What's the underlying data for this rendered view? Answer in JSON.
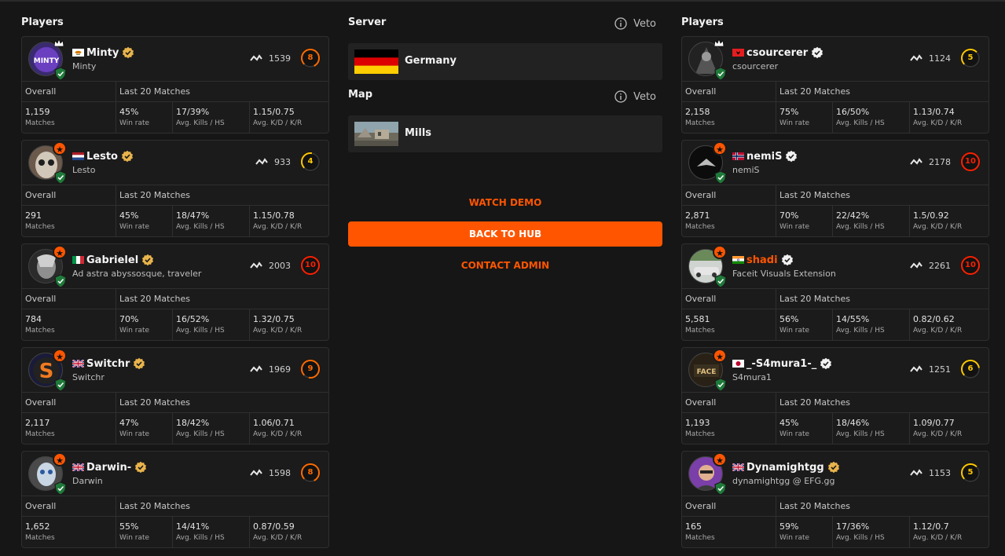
{
  "left": {
    "title": "Players",
    "players": [
      {
        "name": "Minty",
        "sub": "Minty",
        "elo": "1539",
        "level": "8",
        "flag": "cy",
        "verify": "gold",
        "badge": "crown",
        "name_color": "white",
        "overall_label": "Overall",
        "last20_label": "Last 20 Matches",
        "stats": [
          {
            "v": "1,159",
            "l": "Matches"
          },
          {
            "v": "45%",
            "l": "Win rate"
          },
          {
            "v": "17/39%",
            "l": "Avg. Kills / HS"
          },
          {
            "v": "1.15/0.75",
            "l": "Avg. K/D / K/R"
          }
        ]
      },
      {
        "name": "Lesto",
        "sub": "Lesto",
        "elo": "933",
        "level": "4",
        "flag": "nl",
        "verify": "gold",
        "badge": "star",
        "name_color": "white",
        "overall_label": "Overall",
        "last20_label": "Last 20 Matches",
        "stats": [
          {
            "v": "291",
            "l": "Matches"
          },
          {
            "v": "45%",
            "l": "Win rate"
          },
          {
            "v": "18/47%",
            "l": "Avg. Kills / HS"
          },
          {
            "v": "1.15/0.78",
            "l": "Avg. K/D / K/R"
          }
        ]
      },
      {
        "name": "Gabrielel",
        "sub": "Ad astra abyssosque, traveler",
        "elo": "2003",
        "level": "10",
        "flag": "it",
        "verify": "gold",
        "badge": "star",
        "name_color": "white",
        "overall_label": "Overall",
        "last20_label": "Last 20 Matches",
        "stats": [
          {
            "v": "784",
            "l": "Matches"
          },
          {
            "v": "70%",
            "l": "Win rate"
          },
          {
            "v": "16/52%",
            "l": "Avg. Kills / HS"
          },
          {
            "v": "1.32/0.75",
            "l": "Avg. K/D / K/R"
          }
        ]
      },
      {
        "name": "Switchr",
        "sub": "Switchr",
        "elo": "1969",
        "level": "9",
        "flag": "gb",
        "verify": "gold",
        "badge": "star",
        "name_color": "white",
        "overall_label": "Overall",
        "last20_label": "Last 20 Matches",
        "stats": [
          {
            "v": "2,117",
            "l": "Matches"
          },
          {
            "v": "47%",
            "l": "Win rate"
          },
          {
            "v": "18/42%",
            "l": "Avg. Kills / HS"
          },
          {
            "v": "1.06/0.71",
            "l": "Avg. K/D / K/R"
          }
        ]
      },
      {
        "name": "Darwin-",
        "sub": "Darwin",
        "elo": "1598",
        "level": "8",
        "flag": "gb",
        "verify": "gold",
        "badge": "star",
        "name_color": "white",
        "overall_label": "Overall",
        "last20_label": "Last 20 Matches",
        "stats": [
          {
            "v": "1,652",
            "l": "Matches"
          },
          {
            "v": "55%",
            "l": "Win rate"
          },
          {
            "v": "14/41%",
            "l": "Avg. Kills / HS"
          },
          {
            "v": "0.87/0.59",
            "l": "Avg. K/D / K/R"
          }
        ]
      }
    ]
  },
  "right": {
    "title": "Players",
    "players": [
      {
        "name": "csourcerer",
        "sub": "csourcerer",
        "elo": "1124",
        "level": "5",
        "flag": "al",
        "verify": "white",
        "badge": "crown",
        "name_color": "white",
        "overall_label": "Overall",
        "last20_label": "Last 20 Matches",
        "stats": [
          {
            "v": "2,158",
            "l": "Matches"
          },
          {
            "v": "75%",
            "l": "Win rate"
          },
          {
            "v": "16/50%",
            "l": "Avg. Kills / HS"
          },
          {
            "v": "1.13/0.74",
            "l": "Avg. K/D / K/R"
          }
        ]
      },
      {
        "name": "nemiS",
        "sub": "nemiS",
        "elo": "2178",
        "level": "10",
        "flag": "no",
        "verify": "white",
        "badge": "star",
        "name_color": "white",
        "overall_label": "Overall",
        "last20_label": "Last 20 Matches",
        "stats": [
          {
            "v": "2,871",
            "l": "Matches"
          },
          {
            "v": "70%",
            "l": "Win rate"
          },
          {
            "v": "22/42%",
            "l": "Avg. Kills / HS"
          },
          {
            "v": "1.5/0.92",
            "l": "Avg. K/D / K/R"
          }
        ]
      },
      {
        "name": "shadi",
        "sub": "Faceit Visuals Extension",
        "elo": "2261",
        "level": "10",
        "flag": "in",
        "verify": "white",
        "badge": "star",
        "name_color": "orange",
        "overall_label": "Overall",
        "last20_label": "Last 20 Matches",
        "stats": [
          {
            "v": "5,581",
            "l": "Matches"
          },
          {
            "v": "56%",
            "l": "Win rate"
          },
          {
            "v": "14/55%",
            "l": "Avg. Kills / HS"
          },
          {
            "v": "0.82/0.62",
            "l": "Avg. K/D / K/R"
          }
        ]
      },
      {
        "name": "_-S4mura1-_",
        "sub": "S4mura1",
        "elo": "1251",
        "level": "6",
        "flag": "jp",
        "verify": "white",
        "badge": "star",
        "name_color": "white",
        "overall_label": "Overall",
        "last20_label": "Last 20 Matches",
        "stats": [
          {
            "v": "1,193",
            "l": "Matches"
          },
          {
            "v": "45%",
            "l": "Win rate"
          },
          {
            "v": "18/46%",
            "l": "Avg. Kills / HS"
          },
          {
            "v": "1.09/0.77",
            "l": "Avg. K/D / K/R"
          }
        ]
      },
      {
        "name": "Dynamightgg",
        "sub": "dynamightgg @ EFG.gg",
        "elo": "1153",
        "level": "5",
        "flag": "gb",
        "verify": "gold",
        "badge": "star",
        "name_color": "white",
        "overall_label": "Overall",
        "last20_label": "Last 20 Matches",
        "stats": [
          {
            "v": "165",
            "l": "Matches"
          },
          {
            "v": "59%",
            "l": "Win rate"
          },
          {
            "v": "17/36%",
            "l": "Avg. Kills / HS"
          },
          {
            "v": "1.12/0.7",
            "l": "Avg. K/D / K/R"
          }
        ]
      }
    ]
  },
  "server": {
    "title": "Server",
    "veto_label": "Veto",
    "name": "Germany",
    "icon": "germany-flag"
  },
  "map": {
    "title": "Map",
    "veto_label": "Veto",
    "name": "Mills",
    "icon": "mills-map-thumbnail"
  },
  "actions": {
    "watch_demo": "WATCH DEMO",
    "back_to_hub": "BACK TO HUB",
    "contact_admin": "CONTACT ADMIN"
  },
  "colors": {
    "accent": "#ff5500",
    "background": "#161616",
    "card": "#1b1b1b",
    "level_orange": "#ff6a00",
    "level_yellow": "#ffc800",
    "level_red": "#fe1f00"
  }
}
